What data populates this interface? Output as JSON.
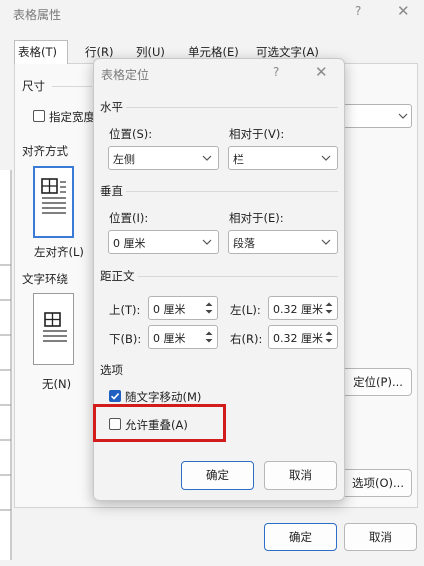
{
  "outer": {
    "title": "表格属性",
    "help": "?",
    "close": "✕",
    "tabs": [
      "表格(T)",
      "行(R)",
      "列(U)",
      "单元格(E)",
      "可选文字(A)"
    ],
    "size_section": "尺寸",
    "specify_width": "指定宽度",
    "alignment_section": "对齐方式",
    "align_left": "左对齐(L)",
    "wrap_section": "文字环绕",
    "wrap_none": "无(N)",
    "positioning_button": "定位(P)...",
    "options_button": "选项(O)...",
    "ok": "确定",
    "cancel": "取消"
  },
  "inner": {
    "title": "表格定位",
    "help": "?",
    "close": "✕",
    "horizontal": {
      "section": "水平",
      "position_label": "位置(S):",
      "position_value": "左侧",
      "relative_label": "相对于(V):",
      "relative_value": "栏"
    },
    "vertical": {
      "section": "垂直",
      "position_label": "位置(I):",
      "position_value": "0 厘米",
      "relative_label": "相对于(E):",
      "relative_value": "段落"
    },
    "distance": {
      "section": "距正文",
      "top_label": "上(T):",
      "top_value": "0 厘米",
      "bottom_label": "下(B):",
      "bottom_value": "0 厘米",
      "left_label": "左(L):",
      "left_value": "0.32 厘米",
      "right_label": "右(R):",
      "right_value": "0.32 厘米"
    },
    "options": {
      "section": "选项",
      "move_with_text": "随文字移动(M)",
      "move_with_text_checked": true,
      "allow_overlap": "允许重叠(A)",
      "allow_overlap_checked": false
    },
    "ok": "确定",
    "cancel": "取消"
  },
  "colors": {
    "accent": "#2f6ec7",
    "highlight": "#d21c1c",
    "checked": "#1f5fbf"
  }
}
